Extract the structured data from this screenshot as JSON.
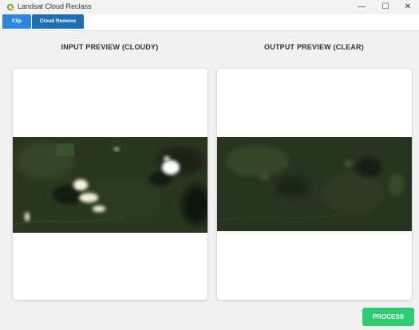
{
  "window": {
    "title": "Landsat Cloud Reclass",
    "controls": {
      "minimize": "—",
      "maximize": "☐",
      "close": "✕"
    }
  },
  "tabs": [
    {
      "label": "Clip"
    },
    {
      "label": "Cloud Remove"
    }
  ],
  "input_panel": {
    "heading": "INPUT PREVIEW (CLOUDY)"
  },
  "output_panel": {
    "heading": "OUTPUT PREVIEW (CLEAR)"
  },
  "actions": {
    "process_label": "PROCESS"
  },
  "colors": {
    "tab_active": "#1f6fb5",
    "tab": "#2e86de",
    "process": "#2ecc71"
  }
}
